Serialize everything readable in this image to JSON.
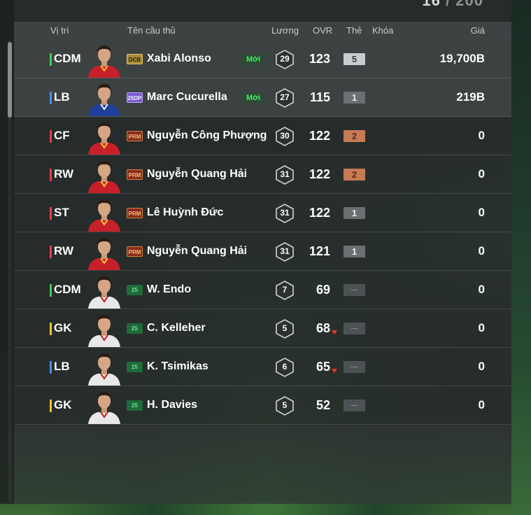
{
  "top_count": {
    "current": "16",
    "separator": "/",
    "max": "200"
  },
  "header": {
    "position": "Vị trí",
    "name": "Tên cầu thủ",
    "wage": "Lương",
    "ovr": "OVR",
    "card": "Thẻ",
    "lock": "Khóa",
    "price": "Giá"
  },
  "colors": {
    "midfielder": "#3ccf5a",
    "defender": "#4a8fe8",
    "forward": "#e8404a",
    "goalkeeper": "#f2c230"
  },
  "players": [
    {
      "position": "CDM",
      "pos_color": "#3ccf5a",
      "season": "DCB",
      "season_class": "s-dcb",
      "name": "Xabi Alonso",
      "new_label": "Mới",
      "wage": "29",
      "ovr": "123",
      "card": "5",
      "card_class": "c-silver",
      "price": "19,700B",
      "ovr_down": false,
      "avatar": "player-red-kit",
      "highlight": true
    },
    {
      "position": "LB",
      "pos_color": "#4a8fe8",
      "season": "25DP",
      "season_class": "s-25dp",
      "name": "Marc Cucurella",
      "new_label": "Mới",
      "wage": "27",
      "ovr": "115",
      "card": "1",
      "card_class": "c-grey",
      "price": "219B",
      "ovr_down": false,
      "avatar": "player-blue-kit",
      "highlight": true
    },
    {
      "position": "CF",
      "pos_color": "#e8404a",
      "season": "PRM",
      "season_class": "s-prm",
      "name": "Nguyễn Công Phượng",
      "new_label": "",
      "wage": "30",
      "ovr": "122",
      "card": "2",
      "card_class": "c-bronze",
      "price": "0",
      "ovr_down": false,
      "avatar": "player-red-kit",
      "highlight": false
    },
    {
      "position": "RW",
      "pos_color": "#e8404a",
      "season": "PRM",
      "season_class": "s-prm",
      "name": "Nguyễn Quang Hải",
      "new_label": "",
      "wage": "31",
      "ovr": "122",
      "card": "2",
      "card_class": "c-bronze",
      "price": "0",
      "ovr_down": false,
      "avatar": "player-red-kit",
      "highlight": false
    },
    {
      "position": "ST",
      "pos_color": "#e8404a",
      "season": "PRM",
      "season_class": "s-prm",
      "name": "Lê Huỳnh Đức",
      "new_label": "",
      "wage": "31",
      "ovr": "122",
      "card": "1",
      "card_class": "c-grey",
      "price": "0",
      "ovr_down": false,
      "avatar": "player-red-kit",
      "highlight": false
    },
    {
      "position": "RW",
      "pos_color": "#e8404a",
      "season": "PRM",
      "season_class": "s-prm",
      "name": "Nguyễn Quang Hải",
      "new_label": "",
      "wage": "31",
      "ovr": "121",
      "card": "1",
      "card_class": "c-grey",
      "price": "0",
      "ovr_down": false,
      "avatar": "player-red-kit",
      "highlight": false
    },
    {
      "position": "CDM",
      "pos_color": "#3ccf5a",
      "season": "25",
      "season_class": "s-25",
      "name": "W. Endo",
      "new_label": "",
      "wage": "7",
      "ovr": "69",
      "card": "—",
      "card_class": "c-empty",
      "price": "0",
      "ovr_down": false,
      "avatar": "player-white-kit",
      "highlight": false
    },
    {
      "position": "GK",
      "pos_color": "#f2c230",
      "season": "25",
      "season_class": "s-25",
      "name": "C. Kelleher",
      "new_label": "",
      "wage": "5",
      "ovr": "68",
      "card": "—",
      "card_class": "c-empty",
      "price": "0",
      "ovr_down": true,
      "avatar": "player-white-kit",
      "highlight": false
    },
    {
      "position": "LB",
      "pos_color": "#4a8fe8",
      "season": "25",
      "season_class": "s-25",
      "name": "K. Tsimikas",
      "new_label": "",
      "wage": "6",
      "ovr": "65",
      "card": "—",
      "card_class": "c-empty",
      "price": "0",
      "ovr_down": true,
      "avatar": "player-white-kit",
      "highlight": false
    },
    {
      "position": "GK",
      "pos_color": "#f2c230",
      "season": "25",
      "season_class": "s-25",
      "name": "H. Davies",
      "new_label": "",
      "wage": "5",
      "ovr": "52",
      "card": "—",
      "card_class": "c-empty",
      "price": "0",
      "ovr_down": false,
      "avatar": "player-white-kit",
      "highlight": false
    }
  ]
}
